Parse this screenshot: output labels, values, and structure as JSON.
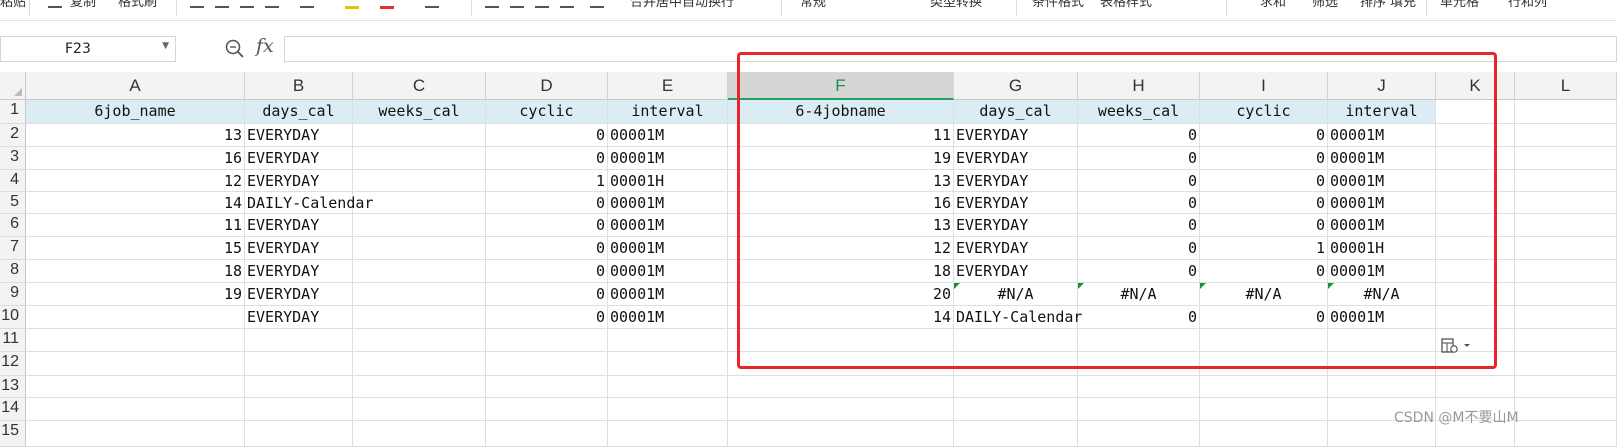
{
  "ribbon": {
    "items": [
      "粘贴",
      "复制",
      "格式刷",
      "合并居中",
      "自动换行",
      "常规",
      "类型转换",
      "条件格式",
      "表格样式",
      "求和",
      "筛选",
      "排序",
      "填充",
      "单元格",
      "行和列"
    ]
  },
  "formula_bar": {
    "name_box": "F23",
    "fx_label": "fx",
    "formula": ""
  },
  "columns": [
    "A",
    "B",
    "C",
    "D",
    "E",
    "F",
    "G",
    "H",
    "I",
    "J",
    "K",
    "L"
  ],
  "selected_column": "F",
  "rows": [
    "1",
    "2",
    "3",
    "4",
    "5",
    "6",
    "7",
    "8",
    "9",
    "10",
    "11",
    "12",
    "13",
    "14",
    "15"
  ],
  "left_table": {
    "headers": [
      "6job_name",
      "days_cal",
      "weeks_cal",
      "cyclic",
      "interval"
    ],
    "rows": [
      [
        "13",
        "EVERYDAY",
        "",
        "0",
        "00001M"
      ],
      [
        "16",
        "EVERYDAY",
        "",
        "0",
        "00001M"
      ],
      [
        "12",
        "EVERYDAY",
        "",
        "1",
        "00001H"
      ],
      [
        "14",
        "DAILY-Calendar",
        "",
        "0",
        "00001M"
      ],
      [
        "11",
        "EVERYDAY",
        "",
        "0",
        "00001M"
      ],
      [
        "15",
        "EVERYDAY",
        "",
        "0",
        "00001M"
      ],
      [
        "18",
        "EVERYDAY",
        "",
        "0",
        "00001M"
      ],
      [
        "19",
        "EVERYDAY",
        "",
        "0",
        "00001M"
      ],
      [
        "",
        "EVERYDAY",
        "",
        "0",
        "00001M"
      ]
    ]
  },
  "right_table": {
    "headers": [
      "6-4jobname",
      "days_cal",
      "weeks_cal",
      "cyclic",
      "interval"
    ],
    "rows": [
      [
        "11",
        "EVERYDAY",
        "0",
        "0",
        "00001M"
      ],
      [
        "19",
        "EVERYDAY",
        "0",
        "0",
        "00001M"
      ],
      [
        "13",
        "EVERYDAY",
        "0",
        "0",
        "00001M"
      ],
      [
        "16",
        "EVERYDAY",
        "0",
        "0",
        "00001M"
      ],
      [
        "13",
        "EVERYDAY",
        "0",
        "0",
        "00001M"
      ],
      [
        "12",
        "EVERYDAY",
        "0",
        "1",
        "00001H"
      ],
      [
        "18",
        "EVERYDAY",
        "0",
        "0",
        "00001M"
      ],
      [
        "20",
        "#N/A",
        "#N/A",
        "#N/A",
        "#N/A"
      ],
      [
        "14",
        "DAILY-Calendar",
        "0",
        "0",
        "00001M"
      ]
    ]
  },
  "watermark": "CSDN @M不要山M",
  "colors": {
    "header_fill": "#dbedf4",
    "annotation_red": "#e8252a",
    "selected_col": "#1e8f4e"
  }
}
